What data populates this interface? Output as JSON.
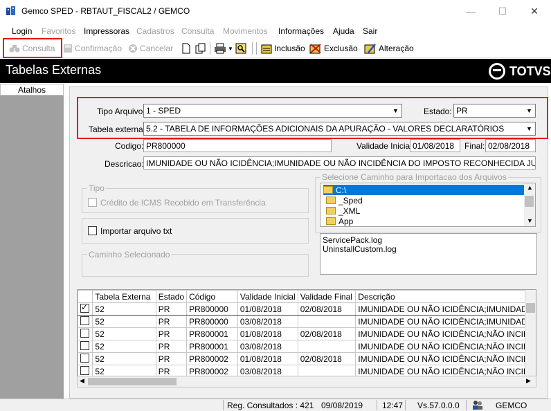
{
  "window": {
    "title": "Gemco SPED - RBTAUT_FISCAL2 / GEMCO",
    "minimize": "—",
    "maximize": "☐",
    "close": "✕"
  },
  "menu": {
    "items": [
      {
        "label": "Login",
        "enabled": true
      },
      {
        "label": "Favoritos",
        "enabled": false
      },
      {
        "label": "Impressoras",
        "enabled": true
      },
      {
        "label": "Cadastros",
        "enabled": false
      },
      {
        "label": "Consulta",
        "enabled": false
      },
      {
        "label": "Movimentos",
        "enabled": false
      },
      {
        "label": "Informações",
        "enabled": true
      },
      {
        "label": "Ajuda",
        "enabled": true
      },
      {
        "label": "Sair",
        "enabled": true
      }
    ]
  },
  "toolbar": {
    "consulta": "Consulta",
    "confirmacao": "Confirmação",
    "cancelar": "Cancelar",
    "inclusao": "Inclusão",
    "exclusao": "Exclusão",
    "alteracao": "Alteração"
  },
  "header": {
    "title": "Tabelas Externas",
    "brand": "TOTVS"
  },
  "sidebar": {
    "title": "Atalhos"
  },
  "form": {
    "tipo_arquivo_label": "Tipo Arquivo:",
    "tipo_arquivo_value": "1 - SPED",
    "estado_label": "Estado:",
    "estado_value": "PR",
    "tabela_externa_label": "Tabela externa:",
    "tabela_externa_value": "5.2 - TABELA DE INFORMAÇÕES ADICIONAIS DA APURAÇÃO - VALORES DECLARATÓRIOS",
    "codigo_label": "Codigo:",
    "codigo_value": "PR800000",
    "validade_inicial_label": "Validade Inicial:",
    "validade_inicial_value": "01/08/2018",
    "final_label": "Final:",
    "final_value": "02/08/2018",
    "descricao_label": "Descricao:",
    "descricao_value": "IMUNIDADE OU NÃO ICIDÊNCIA;IMUNIDADE OU NÃO INCIDÊNCIA DO IMPOSTO RECONHECIDA JUDICIALMENTE"
  },
  "tipo_group": {
    "title": "Tipo",
    "credito_label": "Crédito de ICMS Recebido em Transferência"
  },
  "importar": {
    "label": "Importar  arquivo  txt"
  },
  "caminho_group": {
    "title": "Caminho Selecionado"
  },
  "path_selector": {
    "title": "Selecione Caminho  para Importacao dos Arquivos",
    "folders": [
      "C:\\",
      "_Sped",
      "_XML",
      "App"
    ],
    "files": [
      "ServicePack.log",
      "UninstallCustom.log"
    ]
  },
  "grid": {
    "columns": [
      "Tabela Externa",
      "Estado",
      "Código",
      "Validade Inicial",
      "Validade Final",
      "Descrição"
    ],
    "rows": [
      {
        "checked": true,
        "tabela": "52",
        "estado": "PR",
        "codigo": "PR800000",
        "vi": "01/08/2018",
        "vf": "02/08/2018",
        "desc": "IMUNIDADE OU NÃO ICIDÊNCIA;IMUNIDADE"
      },
      {
        "checked": false,
        "tabela": "52",
        "estado": "PR",
        "codigo": "PR800000",
        "vi": "03/08/2018",
        "vf": "",
        "desc": "IMUNIDADE OU NÃO ICIDÊNCIA;IMUNIDAD"
      },
      {
        "checked": false,
        "tabela": "52",
        "estado": "PR",
        "codigo": "PR800001",
        "vi": "01/08/2018",
        "vf": "02/08/2018",
        "desc": "IMUNIDADE OU NÃO ICIDÊNCIA;NÃO INCID"
      },
      {
        "checked": false,
        "tabela": "52",
        "estado": "PR",
        "codigo": "PR800001",
        "vi": "03/08/2018",
        "vf": "",
        "desc": "IMUNIDADE OU NÃO ICIDÊNCIA;NÃO INCID"
      },
      {
        "checked": false,
        "tabela": "52",
        "estado": "PR",
        "codigo": "PR800002",
        "vi": "01/08/2018",
        "vf": "02/08/2018",
        "desc": "IMUNIDADE OU NÃO ICIDÊNCIA;NÃO INCID"
      },
      {
        "checked": false,
        "tabela": "52",
        "estado": "PR",
        "codigo": "PR800002",
        "vi": "03/08/2018",
        "vf": "",
        "desc": "IMUNIDADE OU NÃO ICIDÊNCIA;NÃO INCID"
      }
    ]
  },
  "status": {
    "reg_consultados": "Reg. Consultados : 421",
    "date": "09/08/2019",
    "time": "12:47",
    "version": "Vs.57.0.0.0",
    "company": "GEMCO"
  }
}
